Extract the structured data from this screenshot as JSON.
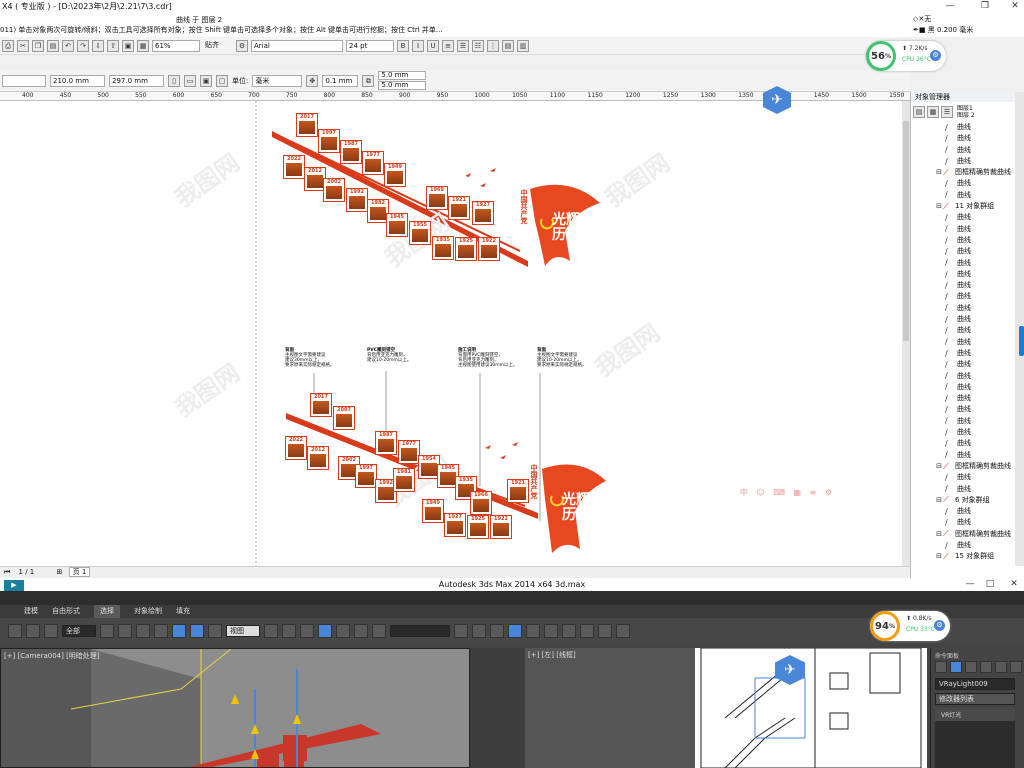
{
  "cdr": {
    "title": "X4 ( 专业版 ) - [D:\\2023年\\2月\\2.21\\7\\3.cdr]",
    "object_info": "曲线 于 图层 2",
    "status_hint": "011) 单击对象两次可旋转/倾斜；双击工具可选择所有对象；按住 Shift 键单击可选择多个对象；按住 Alt 键单击可进行挖掘；按住 Ctrl 并单...",
    "fill_label": "无",
    "outline_label": "黑 0.200 毫米",
    "zoom": "61%",
    "snap_label": "贴齐",
    "font_name": "Arial",
    "font_size": "24 pt",
    "width": "210.0 mm",
    "height": "297.0 mm",
    "unit_label": "单位:",
    "unit_value": "毫米",
    "nudge": "0.1 mm",
    "dup_x": "5.0 mm",
    "dup_y": "5.0 mm",
    "ruler_ticks": [
      "400",
      "450",
      "500",
      "550",
      "600",
      "650",
      "700",
      "750",
      "800",
      "850",
      "900",
      "950",
      "1000",
      "1050",
      "1100",
      "1150",
      "1200",
      "1250",
      "1300",
      "1350",
      "1400",
      "1450",
      "1500",
      "1550"
    ],
    "page_counter": "1 / 1",
    "page_tab": "页 1"
  },
  "design": {
    "party_text": "中国共产党",
    "title_text": "光辉历程",
    "years_top": [
      "2017",
      "2022",
      "2012",
      "1997",
      "2002",
      "1987",
      "1992",
      "1977",
      "1982",
      "1949",
      "1945",
      "1969",
      "1921",
      "1955",
      "1935",
      "1927",
      "1925",
      "1922"
    ],
    "years_bottom": [
      "2017",
      "2022",
      "2012",
      "2007",
      "2002",
      "1997",
      "1992",
      "1987",
      "1981",
      "1977",
      "1954",
      "1945",
      "1949",
      "1935",
      "1927",
      "1921",
      "1925",
      "1922",
      "1966"
    ],
    "notes": [
      {
        "title": "背面",
        "text": "主视图文字需要建议\n建议30mm以上，\n要求原来实际规定规格。"
      },
      {
        "title": "PVC雕刻镂空",
        "text": "背后用亚克力雕刻，\n建议10-20mm以上。"
      },
      {
        "title": "施工说明",
        "text": "背面用PVC雕刻镂空，\n背后用亚克力雕刻，\n主视图使用建议30mm以上。"
      },
      {
        "title": "背面",
        "text": "主视图文字需要建议\n建议10-20mm以上，\n要求原来实际规定规格。"
      }
    ],
    "watermark": "我图网"
  },
  "objmgr": {
    "title": "对象管理器",
    "layers": [
      "图层1",
      "图层 2"
    ],
    "rows": [
      {
        "label": "曲线",
        "type": "curve"
      },
      {
        "label": "曲线",
        "type": "curve"
      },
      {
        "label": "曲线",
        "type": "curve"
      },
      {
        "label": "曲线",
        "type": "curve"
      },
      {
        "label": "图框精确剪裁曲线",
        "type": "group"
      },
      {
        "label": "曲线",
        "type": "curve"
      },
      {
        "label": "曲线",
        "type": "curve"
      },
      {
        "label": "11 对象群组",
        "type": "group"
      },
      {
        "label": "曲线",
        "type": "curve"
      },
      {
        "label": "曲线",
        "type": "curve"
      },
      {
        "label": "曲线",
        "type": "curve"
      },
      {
        "label": "曲线",
        "type": "curve"
      },
      {
        "label": "曲线",
        "type": "curve"
      },
      {
        "label": "曲线",
        "type": "curve"
      },
      {
        "label": "曲线",
        "type": "curve"
      },
      {
        "label": "曲线",
        "type": "curve"
      },
      {
        "label": "曲线",
        "type": "curve"
      },
      {
        "label": "曲线",
        "type": "curve"
      },
      {
        "label": "曲线",
        "type": "curve"
      },
      {
        "label": "曲线",
        "type": "curve"
      },
      {
        "label": "曲线",
        "type": "curve"
      },
      {
        "label": "曲线",
        "type": "curve"
      },
      {
        "label": "曲线",
        "type": "curve"
      },
      {
        "label": "曲线",
        "type": "curve"
      },
      {
        "label": "曲线",
        "type": "curve"
      },
      {
        "label": "曲线",
        "type": "curve"
      },
      {
        "label": "曲线",
        "type": "curve"
      },
      {
        "label": "曲线",
        "type": "curve"
      },
      {
        "label": "曲线",
        "type": "curve"
      },
      {
        "label": "曲线",
        "type": "curve"
      },
      {
        "label": "图框精确剪裁曲线",
        "type": "group"
      },
      {
        "label": "曲线",
        "type": "curve"
      },
      {
        "label": "曲线",
        "type": "curve"
      },
      {
        "label": "6 对象群组",
        "type": "group"
      },
      {
        "label": "曲线",
        "type": "curve"
      },
      {
        "label": "曲线",
        "type": "curve"
      },
      {
        "label": "图框精确剪裁曲线",
        "type": "group"
      },
      {
        "label": "曲线",
        "type": "curve"
      },
      {
        "label": "15 对象群组",
        "type": "group"
      }
    ]
  },
  "cpu_top": {
    "percent": "56",
    "speed": "7.2K/s",
    "temp": "CPU 36°C",
    "color": "#3cc46a"
  },
  "cpu_bottom": {
    "percent": "94",
    "speed": "0.8K/s",
    "temp": "CPU 33°C",
    "color": "#f39c12"
  },
  "max": {
    "title": "Autodesk 3ds Max  2014 x64       3d.max",
    "tabs": [
      "建模",
      "自由形式",
      "选择",
      "对象绘制",
      "填充"
    ],
    "selection_filter": "全部",
    "view_combo": "视图",
    "vp1_label": "[+] [Camera004] [明暗处理]",
    "vp2_label": "[+] [左] [线框]",
    "cmd_title": "命令面板",
    "object_name": "VRayLight009",
    "modifier_list": "修改器列表",
    "modifier_item": "VR灯光"
  }
}
